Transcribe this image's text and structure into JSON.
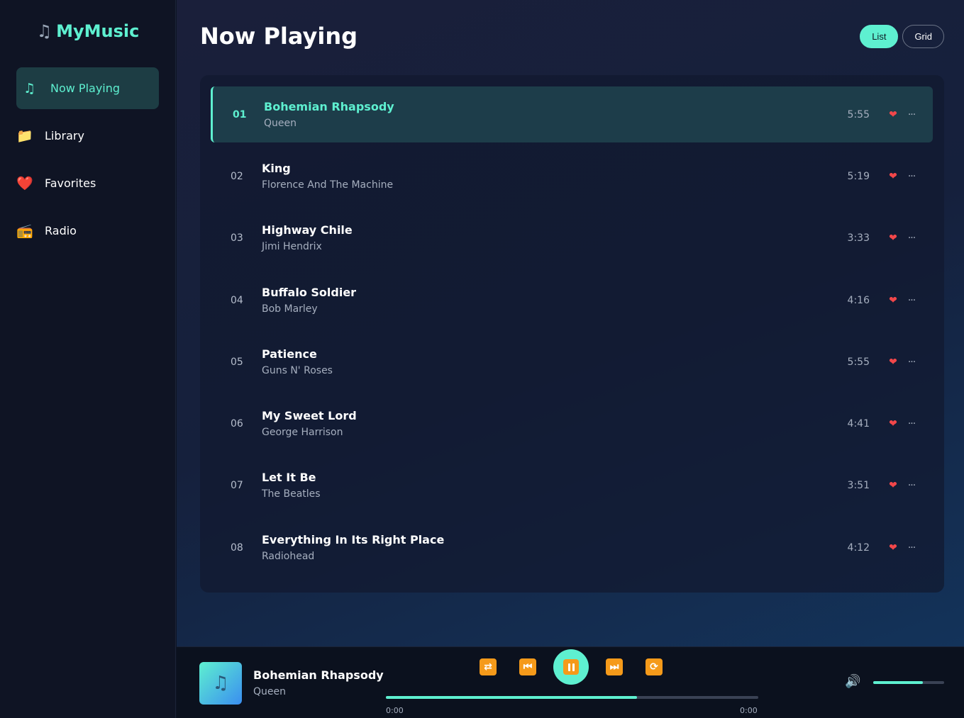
{
  "app": {
    "logo_icon": "♫",
    "logo_text": "MyMusic"
  },
  "sidebar": {
    "items": [
      {
        "icon": "♫",
        "icon_name": "music-note-icon",
        "label": "Now Playing",
        "active": true
      },
      {
        "icon": "📁",
        "icon_name": "folder-icon",
        "label": "Library",
        "active": false
      },
      {
        "icon": "❤️",
        "icon_name": "heart-icon",
        "label": "Favorites",
        "active": false
      },
      {
        "icon": "📻",
        "icon_name": "radio-icon",
        "label": "Radio",
        "active": false
      }
    ]
  },
  "main": {
    "title": "Now Playing",
    "view_toggle": {
      "list_label": "List",
      "grid_label": "Grid",
      "selected": "List"
    }
  },
  "tracks": [
    {
      "num": "01",
      "title": "Bohemian Rhapsody",
      "artist": "Queen",
      "duration": "5:55",
      "active": true
    },
    {
      "num": "02",
      "title": "King",
      "artist": "Florence And The Machine",
      "duration": "5:19",
      "active": false
    },
    {
      "num": "03",
      "title": "Highway Chile",
      "artist": "Jimi Hendrix",
      "duration": "3:33",
      "active": false
    },
    {
      "num": "04",
      "title": "Buffalo Soldier",
      "artist": "Bob Marley",
      "duration": "4:16",
      "active": false
    },
    {
      "num": "05",
      "title": "Patience",
      "artist": "Guns N' Roses",
      "duration": "5:55",
      "active": false
    },
    {
      "num": "06",
      "title": "My Sweet Lord",
      "artist": "George Harrison",
      "duration": "4:41",
      "active": false
    },
    {
      "num": "07",
      "title": "Let It Be",
      "artist": "The Beatles",
      "duration": "3:51",
      "active": false
    },
    {
      "num": "08",
      "title": "Everything In Its Right Place",
      "artist": "Radiohead",
      "duration": "4:12",
      "active": false
    }
  ],
  "track_actions": {
    "heart": "❤",
    "more": "···"
  },
  "player": {
    "album_icon": "♫",
    "title": "Bohemian Rhapsody",
    "artist": "Queen",
    "controls": {
      "shuffle": "⇄",
      "previous": "⏮",
      "next": "⏭",
      "repeat": "⟳"
    },
    "progress_fraction": 0.675,
    "time_current": "0:00",
    "time_total": "0:00",
    "volume_icon": "🔊",
    "volume_fraction": 0.7
  },
  "colors": {
    "accent": "#5ef0d0",
    "control_orange": "#f59a1a",
    "heart": "#f2474a",
    "sidebar_bg": "#0f1424"
  }
}
